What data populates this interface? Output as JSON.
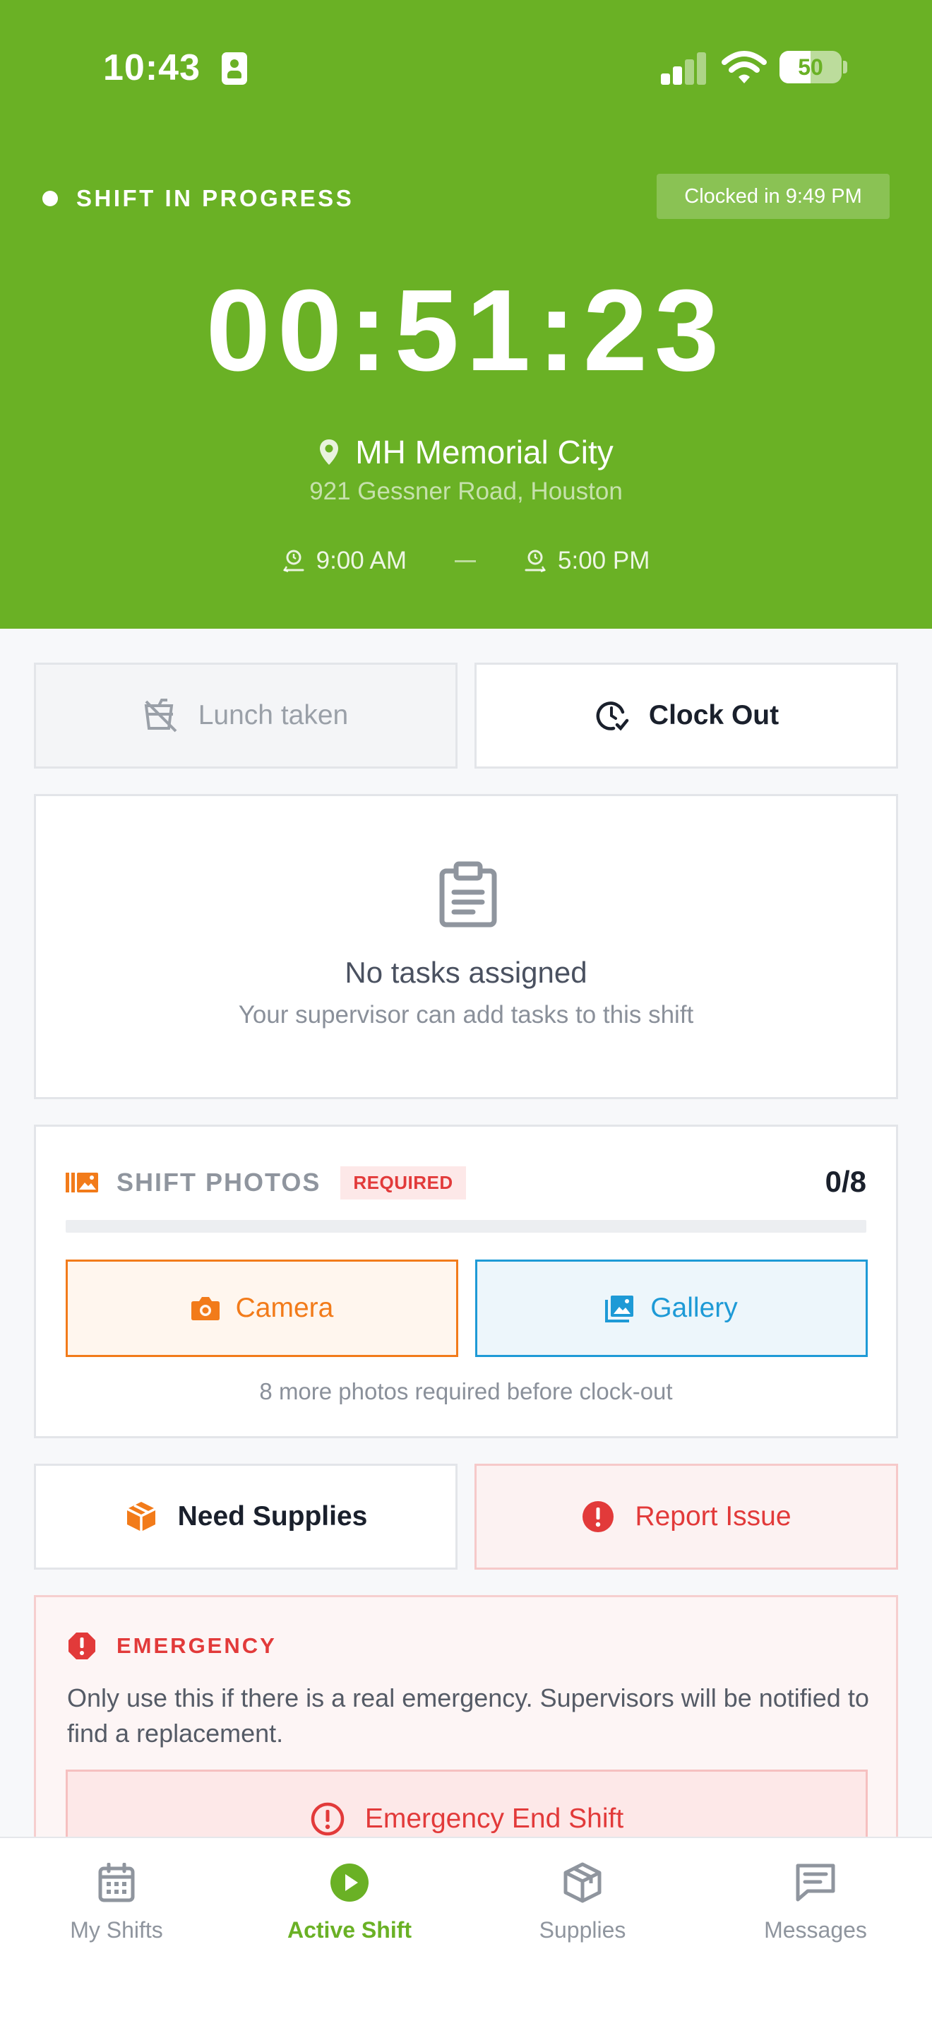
{
  "status_bar": {
    "time": "10:43",
    "battery_level": "50"
  },
  "header": {
    "status_text": "SHIFT IN PROGRESS",
    "clocked_in": "Clocked in 9:49 PM",
    "timer": "00:51:23",
    "location_name": "MH Memorial City",
    "address": "921 Gessner Road, Houston",
    "start_time": "9:00 AM",
    "end_time": "5:00 PM"
  },
  "actions": {
    "lunch_label": "Lunch taken",
    "clock_out_label": "Clock Out"
  },
  "tasks": {
    "title": "No tasks assigned",
    "subtitle": "Your supervisor can add tasks to this shift"
  },
  "photos": {
    "title": "SHIFT PHOTOS",
    "required_badge": "REQUIRED",
    "count": "0/8",
    "progress_fraction": 0,
    "camera_label": "Camera",
    "gallery_label": "Gallery",
    "hint": "8 more photos required before clock-out"
  },
  "quick_actions": {
    "supplies_label": "Need Supplies",
    "report_label": "Report Issue"
  },
  "emergency": {
    "title": "EMERGENCY",
    "text": "Only use this if there is a real emergency. Supervisors will be notified to find a replacement.",
    "button_label": "Emergency End Shift"
  },
  "tabs": [
    {
      "label": "My Shifts",
      "icon": "calendar-icon",
      "active": false
    },
    {
      "label": "Active Shift",
      "icon": "play-circle-icon",
      "active": true
    },
    {
      "label": "Supplies",
      "icon": "box-icon",
      "active": false
    },
    {
      "label": "Messages",
      "icon": "message-icon",
      "active": false
    }
  ],
  "colors": {
    "brand_green": "#6ab125",
    "camera_orange": "#f27b1a",
    "gallery_blue": "#1e9ad6",
    "danger_red": "#e23a3a"
  }
}
